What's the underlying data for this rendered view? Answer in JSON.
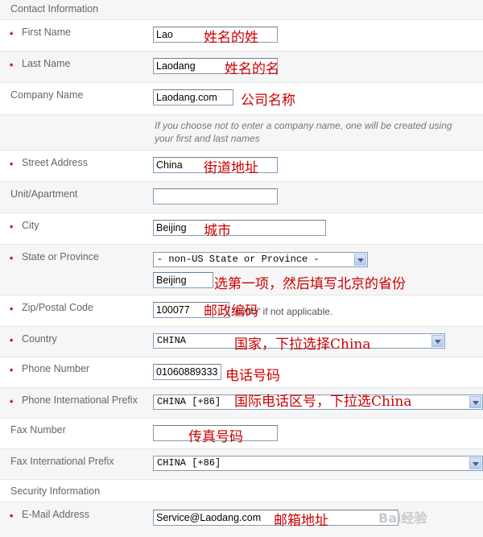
{
  "sections": {
    "contact": "Contact Information",
    "security": "Security Information"
  },
  "labels": {
    "first_name": "First Name",
    "last_name": "Last Name",
    "company": "Company Name",
    "street": "Street Address",
    "unit": "Unit/Apartment",
    "city": "City",
    "state": "State or Province",
    "zip": "Zip/Postal Code",
    "country": "Country",
    "phone": "Phone Number",
    "phone_prefix": "Phone International Prefix",
    "fax": "Fax Number",
    "fax_prefix": "Fax International Prefix",
    "email": "E-Mail Address"
  },
  "required_marker": "*",
  "values": {
    "first_name": "Lao",
    "last_name": "Laodang",
    "company": "Laodang.com",
    "street": "China",
    "unit": "",
    "city": "Beijing",
    "state_select": "- non-US State or Province -",
    "state_text": "Beijing",
    "zip": "100077",
    "country": "CHINA",
    "phone": "01060889333",
    "phone_prefix": "CHINA [+86]",
    "fax": "",
    "fax_prefix": "CHINA [+86]",
    "email": "Service@Laodang.com"
  },
  "hints": {
    "company": "If you choose not to enter a company name, one will be created using your first and last names",
    "zip": "\"0000\" if not applicable."
  },
  "annotations": {
    "first_name": "姓名的姓",
    "last_name": "姓名的名",
    "company": "公司名称",
    "street": "街道地址",
    "city": "城市",
    "state": "选第一项，然后填写北京的省份",
    "zip": "邮政编码",
    "country": "国家，下拉选择China",
    "phone": "电话号码",
    "phone_prefix": "国际电话区号，下拉选China",
    "fax": "传真号码",
    "email": "邮箱地址"
  },
  "watermark": "Bai经验",
  "colors": {
    "annotation": "#cc0000",
    "required": "#a00000",
    "input_border": "#7f9db9"
  }
}
